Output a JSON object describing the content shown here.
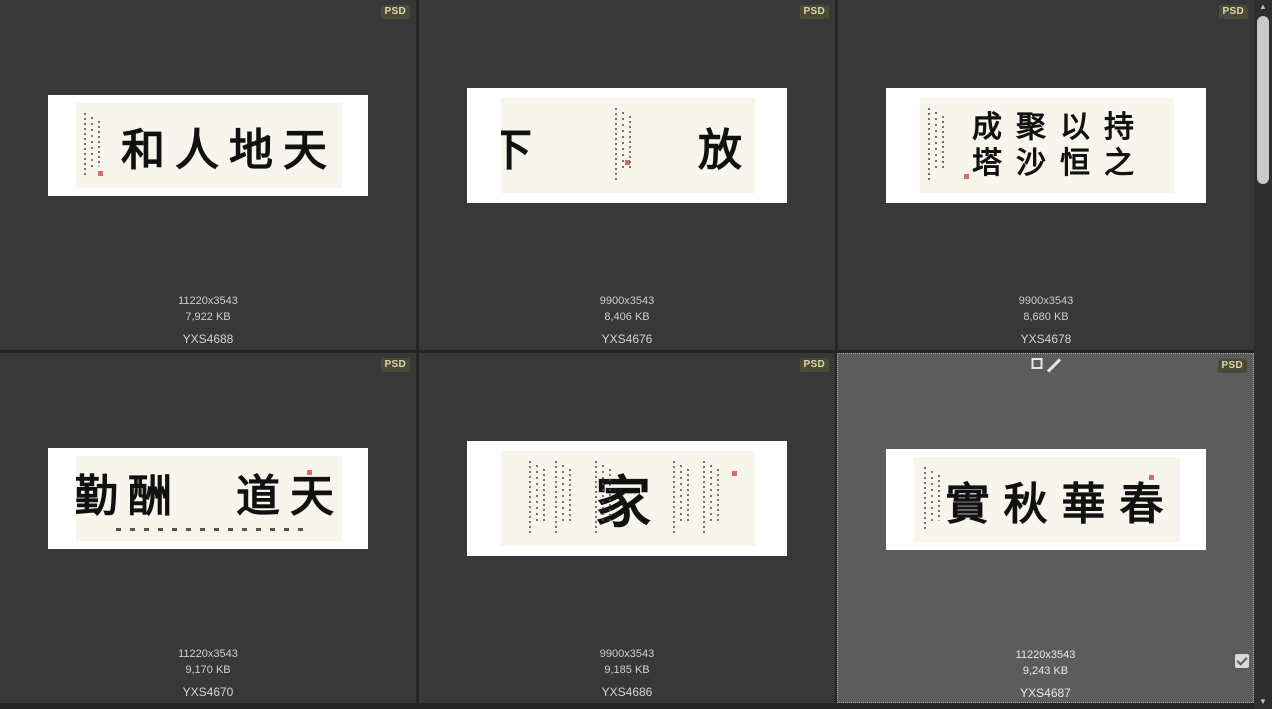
{
  "files": [
    {
      "badge": "PSD",
      "dimensions": "11220x3543",
      "size": "7,922 KB",
      "name": "YXS4688",
      "text": "和人地天",
      "selected": false
    },
    {
      "badge": "PSD",
      "dimensions": "9900x3543",
      "size": "8,406 KB",
      "name": "YXS4676",
      "text": "下　　放",
      "selected": false
    },
    {
      "badge": "PSD",
      "dimensions": "9900x3543",
      "size": "8,680 KB",
      "name": "YXS4678",
      "text_line1": "成聚以持",
      "text_line2": "塔沙恒之",
      "selected": false
    },
    {
      "badge": "PSD",
      "dimensions": "11220x3543",
      "size": "9,170 KB",
      "name": "YXS4670",
      "text": "勤酬　道天",
      "selected": false
    },
    {
      "badge": "PSD",
      "dimensions": "9900x3543",
      "size": "9,185 KB",
      "name": "YXS4686",
      "text": "家",
      "selected": false
    },
    {
      "badge": "PSD",
      "dimensions": "11220x3543",
      "size": "9,243 KB",
      "name": "YXS4687",
      "text": "實秋華春",
      "selected": true
    }
  ],
  "icons": {
    "rect_tool": "square-outline-icon",
    "pen_tool": "pen-icon",
    "selected_check": "checkmark-icon",
    "scroll_up": "arrow-up-icon",
    "scroll_down": "arrow-down-icon"
  },
  "colors": {
    "cell_bg": "#383838",
    "cell_selected_bg": "#5c5c5c",
    "badge_bg": "#4b4a37",
    "badge_text": "#dcd7a8"
  }
}
